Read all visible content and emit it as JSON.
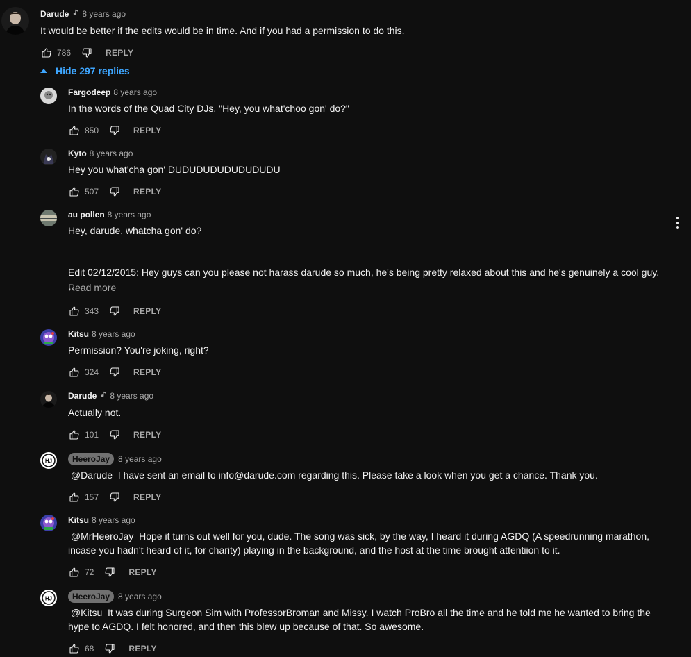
{
  "top_comment": {
    "author": "Darude",
    "time": "8 years ago",
    "text": "It would be better if the edits would be in time. And if you had a permission to do this.",
    "likes": "786",
    "reply_label": "REPLY"
  },
  "replies_toggle": {
    "label": "Hide 297 replies"
  },
  "replies": [
    {
      "author": "Fargodeep",
      "time": "8 years ago",
      "text": "In the words of the Quad City DJs, \"Hey, you what'choo gon' do?\"",
      "likes": "850",
      "reply_label": "REPLY"
    },
    {
      "author": "Kyto",
      "time": "8 years ago",
      "text": "Hey you what'cha gon' DUDUDUDUDUDUDUDU",
      "likes": "507",
      "reply_label": "REPLY"
    },
    {
      "author": "au pollen",
      "time": "8 years ago",
      "text": "Hey, darude, whatcha gon' do?",
      "text2": "Edit 02/12/2015: Hey guys can you please not harass darude so much, he's being pretty relaxed about this and he's genuinely a cool guy. …",
      "read_more": "Read more",
      "likes": "343",
      "reply_label": "REPLY"
    },
    {
      "author": "Kitsu",
      "time": "8 years ago",
      "text": "Permission? You're joking, right?",
      "likes": "324",
      "reply_label": "REPLY"
    },
    {
      "author": "Darude",
      "time": "8 years ago",
      "text": "Actually not.",
      "likes": "101",
      "reply_label": "REPLY"
    },
    {
      "author": "HeeroJay",
      "time": "8 years ago",
      "mention": "@Darude",
      "text": " I have sent an email to info@darude.com regarding this. Please take a look when you get a chance. Thank you.",
      "likes": "157",
      "reply_label": "REPLY"
    },
    {
      "author": "Kitsu",
      "time": "8 years ago",
      "mention": "@MrHeeroJay",
      "text": " Hope it turns out well for you, dude. The song was sick, by the way, I heard it during AGDQ (A speedrunning marathon, incase you hadn't heard of it, for charity) playing in the background, and the host at the time brought attentiion to it.",
      "likes": "72",
      "reply_label": "REPLY"
    },
    {
      "author": "HeeroJay",
      "time": "8 years ago",
      "mention": "@Kitsu",
      "text": " It was during Surgeon Sim with ProfessorBroman and Missy. I watch ProBro all the time and he told me he wanted to bring the hype to AGDQ. I felt honored, and then this blew up because of that. So awesome.",
      "likes": "68",
      "reply_label": "REPLY"
    }
  ],
  "icons": {
    "like": "thumbs-up-icon",
    "dislike": "thumbs-down-icon",
    "music_note": "music-note-icon",
    "more": "more-vert-icon"
  },
  "colors": {
    "background": "#0f0f0f",
    "text": "#f1f1f1",
    "secondary": "#aaaaaa",
    "link": "#3ea6ff"
  }
}
